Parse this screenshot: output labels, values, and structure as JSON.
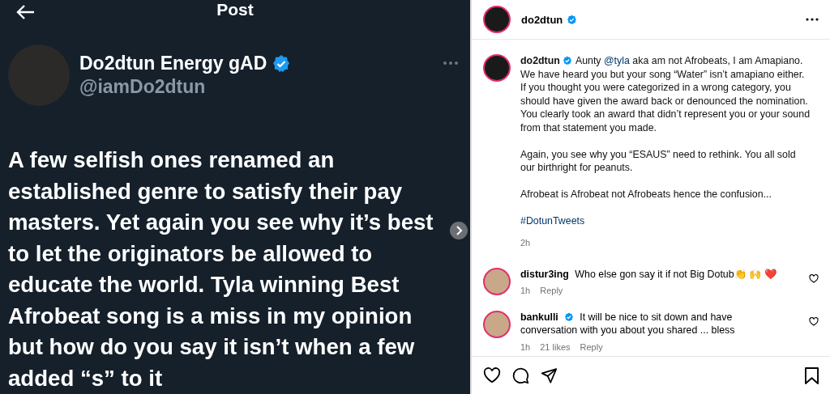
{
  "tweet": {
    "header_title": "Post",
    "author": {
      "name": "Do2dtun Energy gAD",
      "handle": "@iamDo2dtun",
      "verified": true
    },
    "text": "A few selfish ones renamed an established genre to satisfy their pay masters. Yet again you see why it’s best to let the originators be allowed to educate the world. Tyla winning Best Afrobeat song is a miss in my opinion but how do you say it isn’t when a few added “s” to it"
  },
  "post": {
    "username": "do2dtun",
    "verified": true,
    "caption": {
      "username": "do2dtun",
      "verified": true,
      "paragraphs": [
        [
          {
            "kind": "text",
            "text": "Aunty "
          },
          {
            "kind": "mention",
            "text": "@tyla"
          },
          {
            "kind": "text",
            "text": " aka am not Afrobeats, I am Amapiano. We have heard you but your song “Water” isn’t amapiano either. If you thought you were categorized in a wrong category, you should have given the award back or denounced the nomination. You clearly took an award that didn’t represent you or your sound from that statement you made."
          }
        ],
        [
          {
            "kind": "text",
            "text": "Again, you see why you “ESAUS” need to rethink. You all sold our birthright for peanuts."
          }
        ],
        [
          {
            "kind": "text",
            "text": "Afrobeat is Afrobeat not Afrobeats hence the confusion..."
          }
        ],
        [
          {
            "kind": "hashtag",
            "text": "#DotunTweets"
          }
        ]
      ],
      "time": "2h"
    },
    "comments": [
      {
        "username": "distur3ing",
        "verified": false,
        "text": "Who else gon say it if not Big Dotub👏 🙌 ❤️",
        "time": "1h",
        "reply": "Reply"
      },
      {
        "username": "bankulli",
        "verified": true,
        "text": "It will be nice to sit down and have conversation with you about you shared ... bless",
        "time": "1h",
        "likes": "21 likes",
        "reply": "Reply"
      }
    ]
  }
}
